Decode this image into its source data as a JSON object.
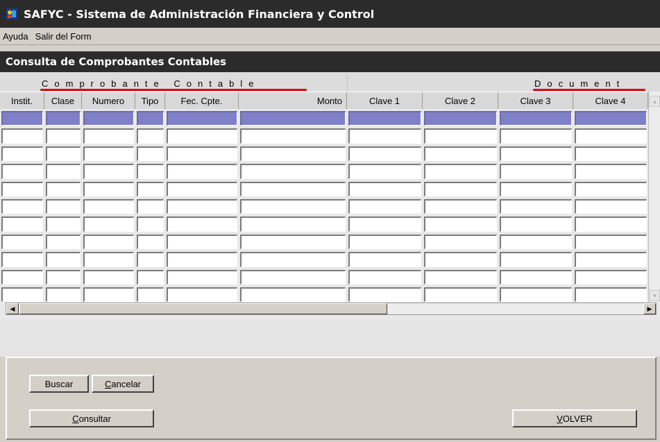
{
  "window": {
    "title": "SAFYC - Sistema de Administración Financiera y Control",
    "icon": "app-logo-icon"
  },
  "menu": {
    "items": [
      {
        "label": "Ayuda"
      },
      {
        "label": "Salir del Form"
      }
    ]
  },
  "form": {
    "title": "Consulta de Comprobantes Contables"
  },
  "grid": {
    "groups": [
      {
        "label": "Comprobante Contable"
      },
      {
        "label": "Document"
      }
    ],
    "columns": [
      {
        "label": "Instit."
      },
      {
        "label": "Clase"
      },
      {
        "label": "Numero"
      },
      {
        "label": "Tipo"
      },
      {
        "label": "Fec. Cpte."
      },
      {
        "label": "Monto"
      },
      {
        "label": "Clave 1"
      },
      {
        "label": "Clave 2"
      },
      {
        "label": "Clave 3"
      },
      {
        "label": "Clave 4"
      }
    ],
    "selected_row": 1,
    "highlight_color": "#8080c8",
    "group_underline_color": "#e00000"
  },
  "buttons": {
    "buscar": "Buscar",
    "cancelar_pre": "",
    "cancelar_u": "C",
    "cancelar_post": "ancelar",
    "consultar_pre": "",
    "consultar_u": "C",
    "consultar_post": "onsultar",
    "volver_pre": "",
    "volver_u": "V",
    "volver_post": "OLVER"
  }
}
